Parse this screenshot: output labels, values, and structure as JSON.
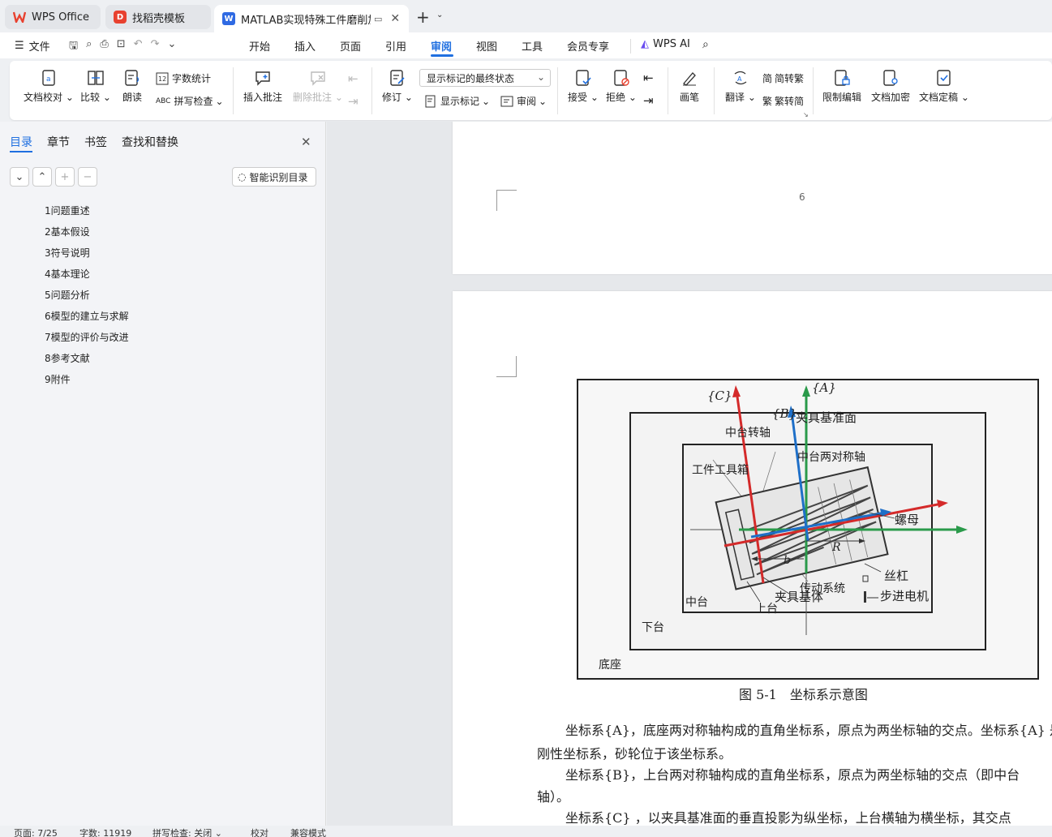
{
  "tabs": [
    {
      "label": "WPS Office",
      "icon": "wps-logo-icon"
    },
    {
      "label": "找稻壳模板",
      "icon": "docer-icon"
    },
    {
      "label": "MATLAB实现特殊工件磨削加工",
      "icon": "word-doc-icon"
    }
  ],
  "menu": {
    "file": "文件",
    "items": [
      "开始",
      "插入",
      "页面",
      "引用",
      "审阅",
      "视图",
      "工具",
      "会员专享"
    ],
    "active": "审阅",
    "wps_ai": "WPS AI"
  },
  "ribbon": {
    "doc_check": "文档校对",
    "compare": "比较",
    "read_aloud": "朗读",
    "word_count": "字数统计",
    "spell_check": "拼写检查",
    "insert_comment": "插入批注",
    "delete_comment": "删除批注",
    "track_changes": "修订",
    "markup_state": "显示标记的最终状态",
    "show_markup": "显示标记",
    "review": "审阅",
    "accept": "接受",
    "reject": "拒绝",
    "pen": "画笔",
    "translate": "翻译",
    "to_traditional": "简转繁",
    "to_simplified": "繁转简",
    "restrict_edit": "限制编辑",
    "encrypt": "文档加密",
    "finalize": "文档定稿"
  },
  "sidebar": {
    "tabs": [
      "目录",
      "章节",
      "书签",
      "查找和替换"
    ],
    "smart_toc": "智能识别目录",
    "toc": [
      "1问题重述",
      "2基本假设",
      "3符号说明",
      "4基本理论",
      "5问题分析",
      "6模型的建立与求解",
      "7模型的评价与改进",
      "8参考文献",
      "9附件"
    ]
  },
  "document": {
    "page_number": "6",
    "figure_caption": "图 5-1　坐标系示意图",
    "figure_labels": {
      "C": "{C}",
      "A": "{A}",
      "B": "{B}",
      "fixture_plane": "夹具基准面",
      "mid_axis": "中台转轴",
      "mid_sym": "中台两对称轴",
      "workpiece_box": "工件工具箱",
      "nut": "螺母",
      "R": "R",
      "b": "b",
      "screw": "丝杠",
      "drive": "传动系统",
      "stepper": "步进电机",
      "fixture_body": "夹具基体",
      "mid_platform": "中台",
      "upper": "上台",
      "lower": "下台",
      "base": "底座"
    },
    "paragraphs": [
      "坐标系{A}，底座两对称轴构成的直角坐标系，原点为两坐标轴的交点。坐标系{A} 是",
      "刚性坐标系，砂轮位于该坐标系。",
      "坐标系{B}，上台两对称轴构成的直角坐标系，原点为两坐标轴的交点（即中台",
      "轴）。",
      "坐标系{C} ，以夹具基准面的垂直投影为纵坐标，上台横轴为横坐标，其交点"
    ]
  },
  "status": {
    "page": "页面: 7/25",
    "words": "字数: 11919",
    "spell": "拼写检查: 关闭",
    "proof": "校对",
    "compat": "兼容模式"
  },
  "colors": {
    "accent": "#1f6fe0",
    "wps_red": "#e8412f"
  }
}
